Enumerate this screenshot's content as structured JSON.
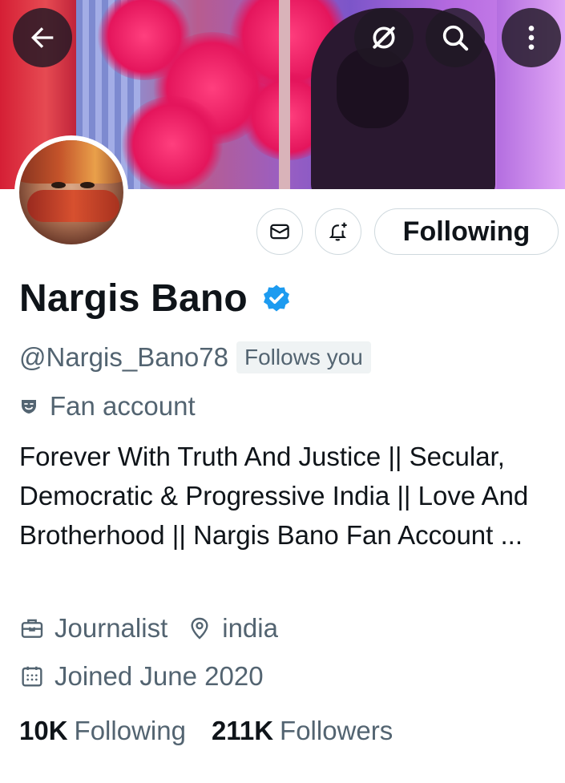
{
  "topbar": {
    "back_icon": "arrow-left-icon",
    "grok_icon": "grok-icon",
    "search_icon": "search-icon",
    "more_icon": "more-vertical-icon"
  },
  "actions": {
    "message_icon": "envelope-icon",
    "notify_icon": "bell-plus-icon",
    "following_label": "Following"
  },
  "profile": {
    "name": "Nargis Bano",
    "verified": true,
    "handle": "@Nargis_Bano78",
    "follows_you": "Follows you",
    "category": "Fan account",
    "bio": "Forever With Truth And Justice || Secular, Democratic & Progressive India || Love And Brotherhood || Nargis Bano Fan Account ...",
    "profession": "Journalist",
    "location": "india",
    "joined": "Joined June 2020"
  },
  "stats": {
    "following_count": "10K",
    "following_label": "Following",
    "followers_count": "211K",
    "followers_label": "Followers"
  },
  "colors": {
    "verified_blue": "#1d9bf0",
    "secondary_text": "#536471",
    "primary_text": "#0f1419",
    "border": "#cfd9de"
  }
}
